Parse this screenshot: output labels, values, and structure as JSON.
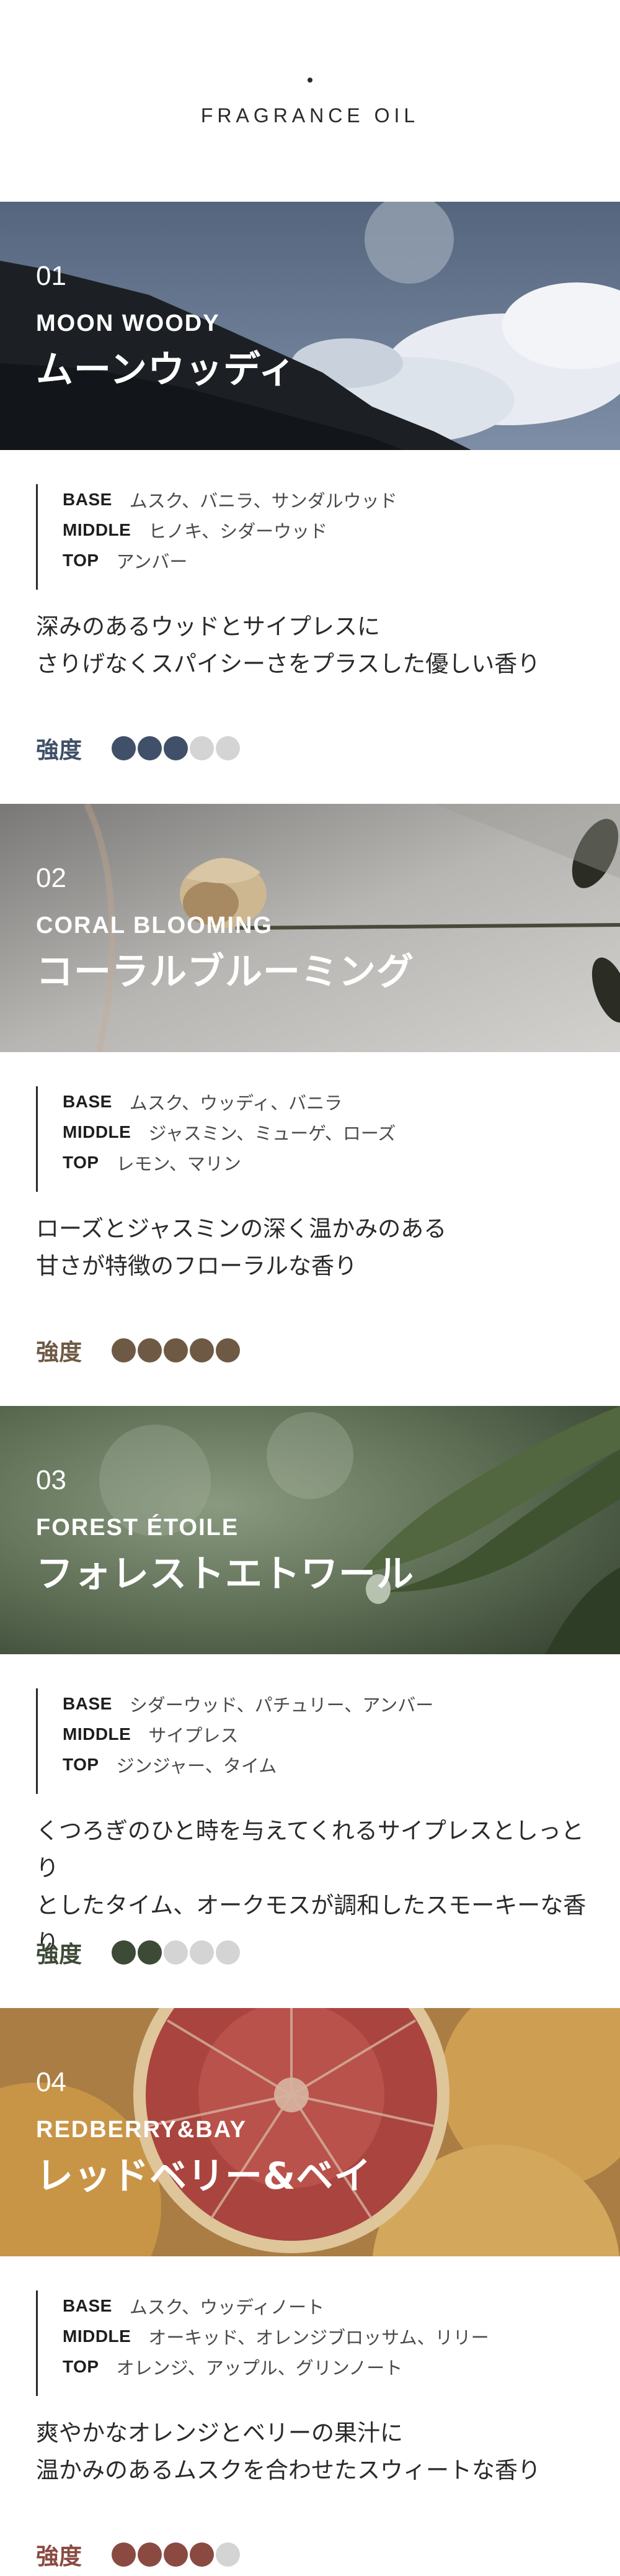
{
  "header": {
    "title": "FRAGRANCE OIL"
  },
  "strength_label": "強度",
  "sections": [
    {
      "number": "01",
      "name_en": "MOON WOODY",
      "name_jp": "ムーンウッディ",
      "notes": [
        {
          "label": "BASE",
          "value": "ムスク、バニラ、サンダルウッド"
        },
        {
          "label": "MIDDLE",
          "value": "ヒノキ、シダーウッド"
        },
        {
          "label": "TOP",
          "value": "アンバー"
        }
      ],
      "description": [
        "深みのあるウッドとサイプレスに",
        "さりげなくスパイシーさをプラスした優しい香り"
      ],
      "strength": 3,
      "strength_max": 5,
      "accent_color": "#3f5068",
      "dot_color": "#3f5068"
    },
    {
      "number": "02",
      "name_en": "CORAL BLOOMING",
      "name_jp": "コーラルブルーミング",
      "notes": [
        {
          "label": "BASE",
          "value": "ムスク、ウッディ、バニラ"
        },
        {
          "label": "MIDDLE",
          "value": "ジャスミン、ミューゲ、ローズ"
        },
        {
          "label": "TOP",
          "value": "レモン、マリン"
        }
      ],
      "description": [
        "ローズとジャスミンの深く温かみのある",
        "甘さが特徴のフローラルな香り"
      ],
      "strength": 5,
      "strength_max": 5,
      "accent_color": "#6e5a44",
      "dot_color": "#6e5a44"
    },
    {
      "number": "03",
      "name_en": "FOREST ÉTOILE",
      "name_jp": "フォレストエトワール",
      "notes": [
        {
          "label": "BASE",
          "value": "シダーウッド、パチュリー、アンバー"
        },
        {
          "label": "MIDDLE",
          "value": "サイプレス"
        },
        {
          "label": "TOP",
          "value": "ジンジャー、タイム"
        }
      ],
      "description": [
        "くつろぎのひと時を与えてくれるサイプレスとしっとり",
        "としたタイム、オークモスが調和したスモーキーな香り"
      ],
      "strength": 2,
      "strength_max": 5,
      "accent_color": "#3c4a36",
      "dot_color": "#3c4a36"
    },
    {
      "number": "04",
      "name_en": "REDBERRY&BAY",
      "name_jp": "レッドベリー&ベイ",
      "notes": [
        {
          "label": "BASE",
          "value": "ムスク、ウッディノート"
        },
        {
          "label": "MIDDLE",
          "value": "オーキッド、オレンジブロッサム、リリー"
        },
        {
          "label": "TOP",
          "value": "オレンジ、アップル、グリンノート"
        }
      ],
      "description": [
        "爽やかなオレンジとベリーの果汁に",
        "温かみのあるムスクを合わせたスウィートな香り"
      ],
      "strength": 4,
      "strength_max": 5,
      "accent_color": "#8a4a42",
      "dot_color": "#8a4a42"
    }
  ]
}
